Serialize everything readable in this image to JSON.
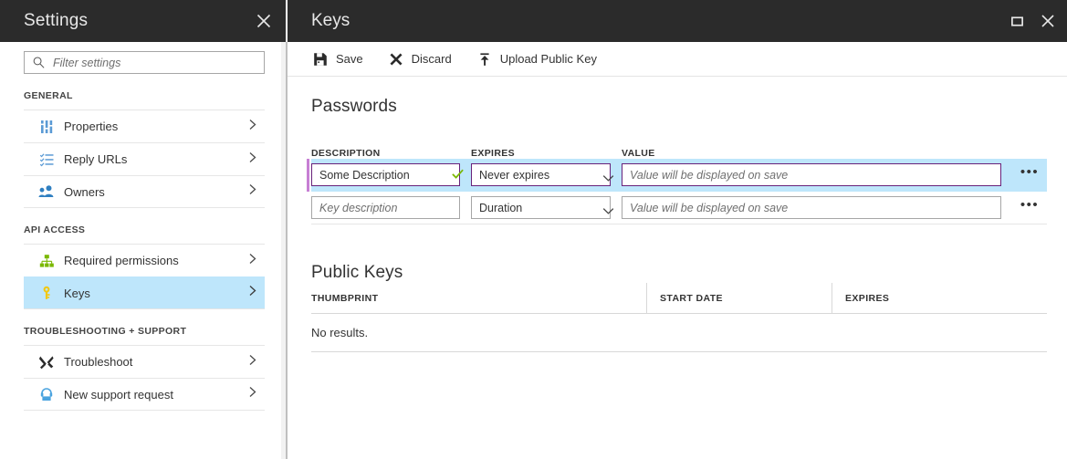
{
  "settings_blade": {
    "title": "Settings",
    "close_icon": "close-icon",
    "search": {
      "placeholder": "Filter settings",
      "value": "",
      "icon": "search-icon"
    },
    "groups": [
      {
        "label": "GENERAL",
        "items": [
          {
            "label": "Properties",
            "icon": "sliders-icon",
            "icon_color": "#5b9bd5",
            "selected": false
          },
          {
            "label": "Reply URLs",
            "icon": "checklist-icon",
            "icon_color": "#5b9bd5",
            "selected": false
          },
          {
            "label": "Owners",
            "icon": "people-icon",
            "icon_color": "#2f7fc1",
            "selected": false
          }
        ]
      },
      {
        "label": "API ACCESS",
        "items": [
          {
            "label": "Required permissions",
            "icon": "hierarchy-icon",
            "icon_color": "#7ab800",
            "selected": false
          },
          {
            "label": "Keys",
            "icon": "key-icon",
            "icon_color": "#f2c811",
            "selected": true
          }
        ]
      },
      {
        "label": "TROUBLESHOOTING + SUPPORT",
        "items": [
          {
            "label": "Troubleshoot",
            "icon": "wrench-screwdriver-icon",
            "icon_color": "#2b2b2b",
            "selected": false
          },
          {
            "label": "New support request",
            "icon": "support-headset-icon",
            "icon_color": "#4aa3df",
            "selected": false
          }
        ]
      }
    ],
    "chevron_icon": "chevron-right-icon",
    "selection_color": "#bee6fb"
  },
  "keys_blade": {
    "title": "Keys",
    "window_buttons": [
      {
        "name": "maximize-icon",
        "label": "Maximize"
      },
      {
        "name": "close-icon",
        "label": "Close"
      }
    ],
    "toolbar": [
      {
        "label": "Save",
        "icon": "save-floppy-icon"
      },
      {
        "label": "Discard",
        "icon": "discard-x-icon"
      },
      {
        "label": "Upload Public Key",
        "icon": "upload-arrow-icon"
      }
    ],
    "passwords": {
      "section_title": "Passwords",
      "columns": [
        "DESCRIPTION",
        "EXPIRES",
        "VALUE"
      ],
      "rows": [
        {
          "active": true,
          "description_value": "Some Description",
          "description_placeholder": "Key description",
          "expires_value": "Never expires",
          "value_value": "",
          "value_placeholder": "Value will be displayed on save",
          "validated": true,
          "more_label": "•••"
        },
        {
          "active": false,
          "description_value": "",
          "description_placeholder": "Key description",
          "expires_value": "Duration",
          "value_value": "",
          "value_placeholder": "Value will be displayed on save",
          "validated": false,
          "more_label": "•••"
        }
      ],
      "accent_marker_color": "#c77fd4",
      "active_row_color": "#bee6fb",
      "focus_border_color": "#68217a",
      "valid_check_color": "#7ab800"
    },
    "public_keys": {
      "section_title": "Public Keys",
      "columns": [
        "THUMBPRINT",
        "START DATE",
        "EXPIRES"
      ],
      "empty_text": "No results."
    }
  }
}
